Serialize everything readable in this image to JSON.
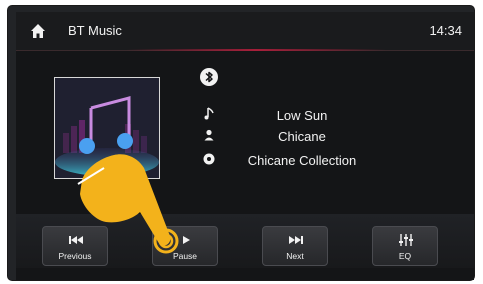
{
  "topbar": {
    "home_icon": "home-icon",
    "title": "BT Music",
    "time": "14:34"
  },
  "track": {
    "bluetooth_icon": "bluetooth-icon",
    "song": "Low Sun",
    "artist": "Chicane",
    "album": "Chicane Collection",
    "icons": [
      "music-note-icon",
      "person-icon",
      "disc-icon"
    ]
  },
  "controls": {
    "previous": {
      "label": "Previous",
      "icon": "skip-previous-icon"
    },
    "pause": {
      "label": "Pause",
      "icon": "play-icon"
    },
    "next": {
      "label": "Next",
      "icon": "skip-next-icon"
    },
    "eq": {
      "label": "EQ",
      "icon": "equalizer-icon"
    }
  },
  "colors": {
    "screen_bg": "#141517",
    "text": "#f2f2f2",
    "accent_red": "#b41e3c",
    "hand_yellow": "#f3b21b"
  }
}
